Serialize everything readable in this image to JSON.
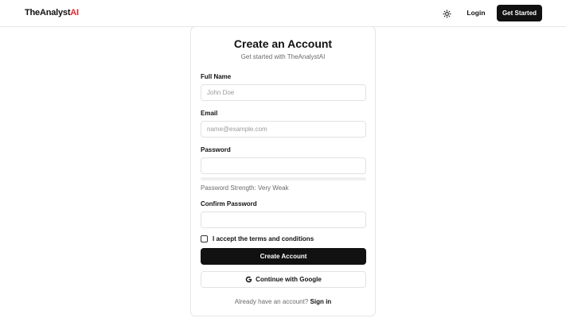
{
  "header": {
    "logo_main": "TheAnalyst",
    "logo_accent": "AI",
    "login_label": "Login",
    "get_started_label": "Get Started"
  },
  "form": {
    "title": "Create an Account",
    "subtitle": "Get started with TheAnalystAI",
    "full_name": {
      "label": "Full Name",
      "placeholder": "John Doe",
      "value": ""
    },
    "email": {
      "label": "Email",
      "placeholder": "name@example.com",
      "value": ""
    },
    "password": {
      "label": "Password",
      "value": ""
    },
    "strength": {
      "text": "Password Strength: Very Weak",
      "level": 0
    },
    "confirm_password": {
      "label": "Confirm Password",
      "value": ""
    },
    "terms": {
      "label": "I accept the terms and conditions",
      "checked": false
    },
    "submit_label": "Create Account",
    "google_label": "Continue with Google",
    "signin_prompt": "Already have an account?",
    "signin_link": "Sign in"
  },
  "colors": {
    "accent": "#e0262b",
    "primary": "#111111",
    "muted": "#6b6b6b",
    "border": "#e2e2e2"
  },
  "icons": {
    "theme_toggle": "sun-icon",
    "google": "google-icon"
  }
}
